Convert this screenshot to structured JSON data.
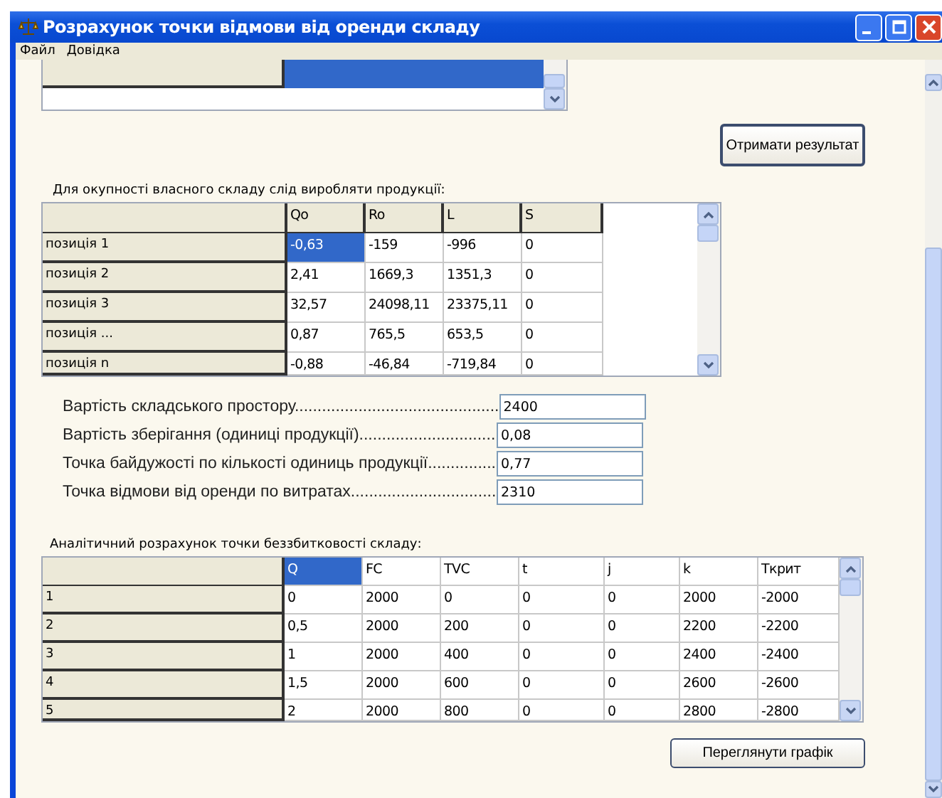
{
  "window": {
    "title": "Розрахунок точки відмови від оренди складу"
  },
  "menu": [
    "Файл",
    "Довідка"
  ],
  "upper_table": {
    "cells": [
      {
        "selected": true
      }
    ]
  },
  "result_button": "Отримати результат",
  "results_caption": "Для окупності власного складу слід виробляти продукції:",
  "results_table": {
    "columns": [
      {
        "label": "Qo",
        "selected": false
      },
      {
        "label": "Ro",
        "selected": false
      },
      {
        "label": "L",
        "selected": false
      },
      {
        "label": "S",
        "selected": false
      }
    ],
    "rows": [
      {
        "header": "позиція 1",
        "cells": [
          {
            "text": "-0,63",
            "selected": true
          },
          {
            "text": "-159",
            "selected": false
          },
          {
            "text": "-996",
            "selected": false
          },
          {
            "text": "0",
            "selected": false
          }
        ]
      },
      {
        "header": "позиція 2",
        "cells": [
          {
            "text": "2,41",
            "selected": false
          },
          {
            "text": "1669,3",
            "selected": false
          },
          {
            "text": "1351,3",
            "selected": false
          },
          {
            "text": "0",
            "selected": false
          }
        ]
      },
      {
        "header": "позиція 3",
        "cells": [
          {
            "text": "32,57",
            "selected": false
          },
          {
            "text": "24098,11",
            "selected": false
          },
          {
            "text": "23375,11",
            "selected": false
          },
          {
            "text": "0",
            "selected": false
          }
        ]
      },
      {
        "header": "позиція ...",
        "cells": [
          {
            "text": "0,87",
            "selected": false
          },
          {
            "text": "765,5",
            "selected": false
          },
          {
            "text": "653,5",
            "selected": false
          },
          {
            "text": "0",
            "selected": false
          }
        ]
      },
      {
        "header": "позиція n",
        "cells": [
          {
            "text": "-0,88",
            "selected": false
          },
          {
            "text": "-46,84",
            "selected": false
          },
          {
            "text": "-719,84",
            "selected": false
          },
          {
            "text": "0",
            "selected": false
          }
        ]
      }
    ]
  },
  "fields": [
    {
      "label": "Вартість складського простору.............................................",
      "value": "2400"
    },
    {
      "label": "Вартість зберігання (одиниці продукції)..............................",
      "value": "0,08"
    },
    {
      "label": "Точка байдужості по кількості одиниць продукції...............",
      "value": "0,77"
    },
    {
      "label": "Точка відмови від оренди по витратах................................",
      "value": "2310"
    }
  ],
  "breakeven_caption": "Аналітичний розрахунок точки беззбитковості складу:",
  "breakeven_table": {
    "columns": [
      {
        "label": "Q",
        "selected": true
      },
      {
        "label": "FC",
        "selected": false
      },
      {
        "label": "TVC",
        "selected": false
      },
      {
        "label": "t",
        "selected": false
      },
      {
        "label": "j",
        "selected": false
      },
      {
        "label": "k",
        "selected": false
      },
      {
        "label": "Ткрит",
        "selected": false
      }
    ],
    "rows": [
      {
        "header": "1",
        "cells": [
          {
            "text": "0",
            "selected": false
          },
          {
            "text": "2000",
            "selected": false
          },
          {
            "text": "0",
            "selected": false
          },
          {
            "text": "0",
            "selected": false
          },
          {
            "text": "0",
            "selected": false
          },
          {
            "text": "2000",
            "selected": false
          },
          {
            "text": "-2000",
            "selected": false
          }
        ]
      },
      {
        "header": "2",
        "cells": [
          {
            "text": "0,5",
            "selected": false
          },
          {
            "text": "2000",
            "selected": false
          },
          {
            "text": "200",
            "selected": false
          },
          {
            "text": "0",
            "selected": false
          },
          {
            "text": "0",
            "selected": false
          },
          {
            "text": "2200",
            "selected": false
          },
          {
            "text": "-2200",
            "selected": false
          }
        ]
      },
      {
        "header": "3",
        "cells": [
          {
            "text": "1",
            "selected": false
          },
          {
            "text": "2000",
            "selected": false
          },
          {
            "text": "400",
            "selected": false
          },
          {
            "text": "0",
            "selected": false
          },
          {
            "text": "0",
            "selected": false
          },
          {
            "text": "2400",
            "selected": false
          },
          {
            "text": "-2400",
            "selected": false
          }
        ]
      },
      {
        "header": "4",
        "cells": [
          {
            "text": "1,5",
            "selected": false
          },
          {
            "text": "2000",
            "selected": false
          },
          {
            "text": "600",
            "selected": false
          },
          {
            "text": "0",
            "selected": false
          },
          {
            "text": "0",
            "selected": false
          },
          {
            "text": "2600",
            "selected": false
          },
          {
            "text": "-2600",
            "selected": false
          }
        ]
      },
      {
        "header": "5",
        "cells": [
          {
            "text": "2",
            "selected": false
          },
          {
            "text": "2000",
            "selected": false
          },
          {
            "text": "800",
            "selected": false
          },
          {
            "text": "0",
            "selected": false
          },
          {
            "text": "0",
            "selected": false
          },
          {
            "text": "2800",
            "selected": false
          },
          {
            "text": "-2800",
            "selected": false
          }
        ]
      }
    ]
  },
  "chart_button": "Переглянути графік"
}
